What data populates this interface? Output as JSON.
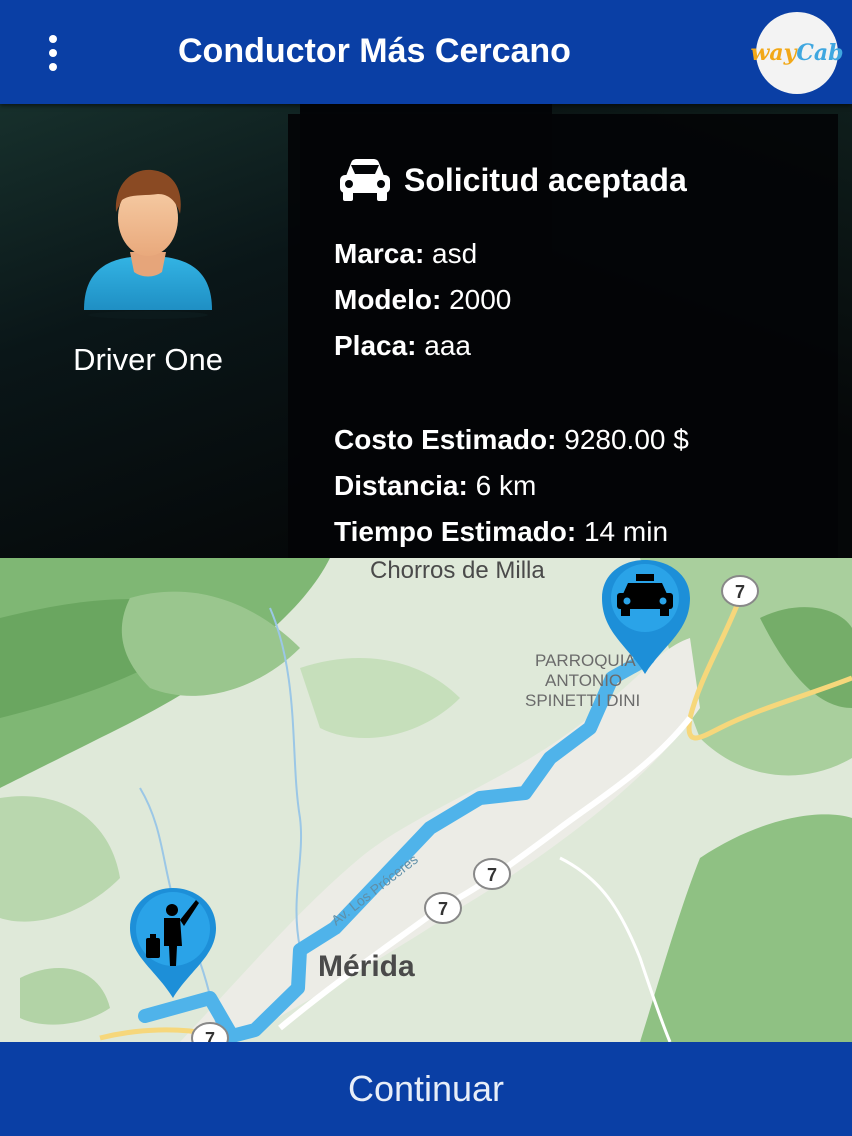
{
  "header": {
    "title": "Conductor Más Cercano",
    "menu_icon": "more-vert-icon",
    "logo_text_a": "way",
    "logo_text_b": "Cab"
  },
  "driver": {
    "name": "Driver One",
    "avatar_icon": "person-avatar-icon"
  },
  "request": {
    "status": "Solicitud aceptada",
    "status_icon": "car-icon",
    "details": [
      {
        "label": "Marca:",
        "value": "asd"
      },
      {
        "label": "Modelo:",
        "value": "2000"
      },
      {
        "label": "Placa:",
        "value": "aaa"
      },
      {
        "label": "Costo Estimado:",
        "value": "9280.00 $"
      },
      {
        "label": "Distancia:",
        "value": "6 km"
      },
      {
        "label": "Tiempo Estimado:",
        "value": "14 min"
      }
    ]
  },
  "map": {
    "labels": {
      "place_top": "Chorros de Milla",
      "parish_1": "PARROQUIA",
      "parish_2": "ANTONIO",
      "parish_3": "SPINETTI DINI",
      "street": "Av. Los Próceres",
      "city": "Mérida",
      "road_shield": "7"
    },
    "driver_marker_icon": "taxi-marker-icon",
    "passenger_marker_icon": "passenger-marker-icon",
    "route_color": "#4fb3ea"
  },
  "footer": {
    "continue_label": "Continuar"
  },
  "colors": {
    "primary": "#0a3fa5",
    "panel": "#030507"
  }
}
